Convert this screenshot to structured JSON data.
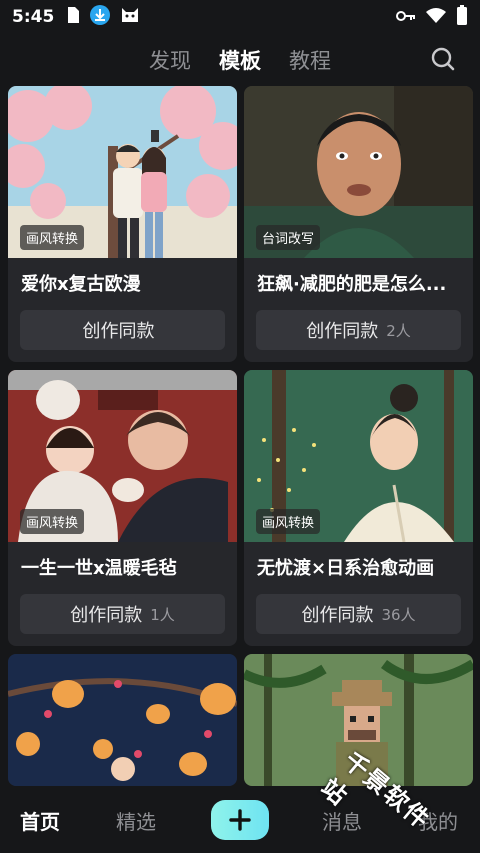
{
  "status_bar": {
    "time": "5:45",
    "icons_left": [
      "sim-card-icon",
      "download-icon",
      "cat-app-icon"
    ],
    "icons_right": [
      "key-icon",
      "wifi-icon",
      "battery-icon"
    ]
  },
  "top_tabs": [
    {
      "label": "发现",
      "active": false
    },
    {
      "label": "模板",
      "active": true
    },
    {
      "label": "教程",
      "active": false
    }
  ],
  "cards": [
    {
      "title": "爱你x复古欧漫",
      "tag": "画风转换",
      "button_label": "创作同款",
      "count": ""
    },
    {
      "title": "狂飙·减肥的肥是怎么...",
      "tag": "台词改写",
      "button_label": "创作同款",
      "count": "2人"
    },
    {
      "title": "一生一世x温暖毛毡",
      "tag": "画风转换",
      "button_label": "创作同款",
      "count": "1人"
    },
    {
      "title": "无忧渡×日系治愈动画",
      "tag": "画风转换",
      "button_label": "创作同款",
      "count": "36人"
    }
  ],
  "bottom_nav": {
    "home": "首页",
    "featured": "精选",
    "messages": "消息",
    "mine": "我的"
  },
  "watermark": "千景软件站",
  "colors": {
    "background": "#161719",
    "card": "#26272b",
    "button": "#35363b",
    "accent_start": "#8ff3ea",
    "accent_end": "#6ee3f2"
  }
}
